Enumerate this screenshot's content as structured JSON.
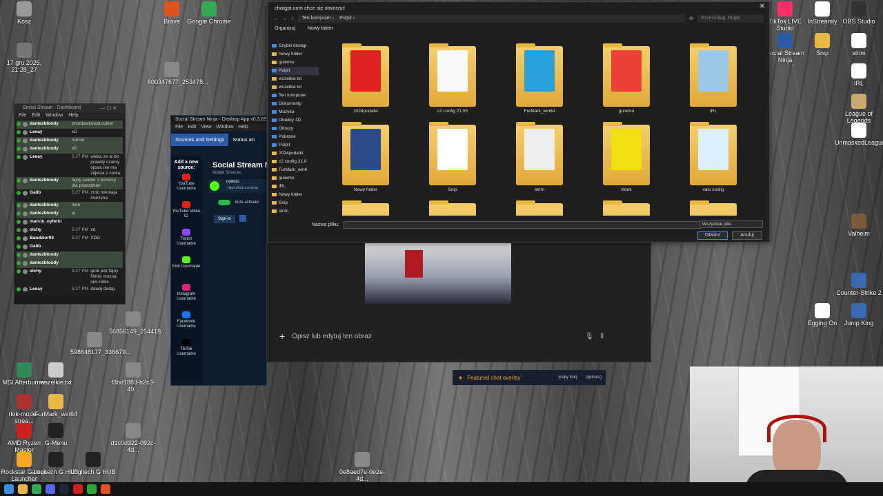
{
  "desktop": {
    "icons_left": [
      {
        "label": "Kosz",
        "color": "#999999"
      },
      {
        "label": "17 gru 2025, 21:28_27",
        "color": "#777777"
      },
      {
        "label": "Brave",
        "color": "#e0531f"
      },
      {
        "label": "Google Chrome",
        "color": "#34a853"
      },
      {
        "label": "600347677_253478...",
        "color": "#888888"
      },
      {
        "label": "56856149_254418...",
        "color": "#888888"
      },
      {
        "label": "598648177_336679...",
        "color": "#888888"
      },
      {
        "label": "MSI Afterburner",
        "color": "#2e8b57"
      },
      {
        "label": "wszelkie.txt",
        "color": "#cccccc"
      },
      {
        "label": "f3bd1883-b2c3-49...",
        "color": "#888888"
      },
      {
        "label": "rlok-model-strea...",
        "color": "#b03030"
      },
      {
        "label": "FurMark_win64",
        "color": "#e8b840"
      },
      {
        "label": "AMD Ryzen Master",
        "color": "#cc2222"
      },
      {
        "label": "G-Menu",
        "color": "#222222"
      },
      {
        "label": "d1c0d322-092c-4d...",
        "color": "#888888"
      },
      {
        "label": "Rockstar Games Launcher",
        "color": "#f5a623"
      },
      {
        "label": "Logitech G HUB",
        "color": "#222222"
      },
      {
        "label": "Logitech G HUB",
        "color": "#222222"
      },
      {
        "label": "0e8aed7e-0e2e-4d...",
        "color": "#888888"
      }
    ],
    "icons_right": [
      {
        "label": "TikTok LIVE Studio",
        "color": "#ff2d6a"
      },
      {
        "label": "InStreamly",
        "color": "#ffffff"
      },
      {
        "label": "OBS Studio",
        "color": "#333333"
      },
      {
        "label": "Social Stream Ninja",
        "color": "#2c5ca8"
      },
      {
        "label": "Snip",
        "color": "#e8b840"
      },
      {
        "label": "strim",
        "color": "#ffffff"
      },
      {
        "label": "IRL",
        "color": "#ffffff"
      },
      {
        "label": "League of Legends",
        "color": "#c8aa6e"
      },
      {
        "label": "UnmaskedLeague...",
        "color": "#ffffff"
      },
      {
        "label": "Valheim",
        "color": "#7a5a3a"
      },
      {
        "label": "Counter-Strike 2",
        "color": "#3a6ab0"
      },
      {
        "label": "Egging On",
        "color": "#ffffff"
      },
      {
        "label": "Jump King",
        "color": "#3a6ab0"
      }
    ]
  },
  "dashboard": {
    "title": "Social Stream - Dashboard",
    "menu": [
      "File",
      "Edit",
      "Window",
      "Help"
    ],
    "chat": [
      {
        "name": "dantezbloody",
        "time": "",
        "msg": "przedawkowal cukier",
        "hl": true
      },
      {
        "name": "Leeay",
        "time": "",
        "msg": "xD",
        "hl": false
      },
      {
        "name": "dantezbloody",
        "time": "",
        "msg": "rumun",
        "hl": true
      },
      {
        "name": "dantezbloody",
        "time": "",
        "msg": "xD",
        "hl": true
      },
      {
        "name": "Leeay",
        "time": "5:27 PM",
        "msg": "widac ze ai bo prawdy czarny ojciec nie ma zdjecia z corka",
        "hl": false
      },
      {
        "name": "dantezbloody",
        "time": "",
        "msg": "fajny sweter z pomocy dla powodzian",
        "hl": true
      },
      {
        "name": "Galib",
        "time": "5:27 PM",
        "msg": "zrob mikolaja murzyna",
        "hl": false
      },
      {
        "name": "dantezbloody",
        "time": "",
        "msg": "leee",
        "hl": true
      },
      {
        "name": "dantezbloody",
        "time": "",
        "msg": "ai",
        "hl": true
      },
      {
        "name": "marcin_oyferki",
        "time": "",
        "msg": "",
        "hl": false
      },
      {
        "name": "olchy",
        "time": "5:27 PM",
        "msg": "xd",
        "hl": false
      },
      {
        "name": "Bandzior93",
        "time": "5:27 PM",
        "msg": "XDD",
        "hl": false
      },
      {
        "name": "Galib",
        "time": "",
        "msg": "",
        "hl": false
      },
      {
        "name": "dantezbloody",
        "time": "",
        "msg": "",
        "hl": true
      },
      {
        "name": "dantezbloody",
        "time": "",
        "msg": "",
        "hl": true
      },
      {
        "name": "olchy",
        "time": "5:27 PM",
        "msg": "grok jest fajny filmiki mozna nim robic",
        "hl": false
      },
      {
        "name": "Leeay",
        "time": "5:27 PM",
        "msg": "dawaj dodaj spatena do jakiegos zdjecia komus xD",
        "hl": false
      }
    ]
  },
  "ninja": {
    "title": "Social Stream Ninja - Desktop App v0.3.69",
    "menu": [
      "File",
      "Edit",
      "View",
      "Window",
      "Help"
    ],
    "tabs": [
      "Sources and Settings",
      "Status an"
    ],
    "add_source": "Add a new source:",
    "heading": "Social Stream N",
    "added_sources": "Added Sources:",
    "source_name": "nowciu",
    "source_url": "https://kick.com/pop",
    "auto_activate": "Auto-activate",
    "sign_in": "Sign-in",
    "platforms": [
      {
        "label": "YouTube Username",
        "color": "#e62117"
      },
      {
        "label": "YouTube Video ID",
        "color": "#e62117"
      },
      {
        "label": "Twitch Username",
        "color": "#9146ff"
      },
      {
        "label": "Kick Username",
        "color": "#53fc18"
      },
      {
        "label": "Instagram Username",
        "color": "#d62976"
      },
      {
        "label": "Facebook Username",
        "color": "#1877f2"
      },
      {
        "label": "TikTok Username",
        "color": "#000000"
      }
    ]
  },
  "gpt": {
    "placeholder": "Opisz lub edytuj ten obraz",
    "overlay_label": "Featured chat overlay",
    "copy_link": "(copy link)",
    "options": "(options)"
  },
  "dialog": {
    "title": "chatgpt.com chce się otworzyć",
    "path": [
      "Ten komputer",
      "Pulpit"
    ],
    "search_placeholder": "Przeszukaj: Pulpit",
    "organize": "Organizuj",
    "new_folder": "Nowy folder",
    "nav": [
      {
        "label": "Szybki dostęp",
        "type": "b"
      },
      {
        "label": "Nowy folder",
        "type": "f"
      },
      {
        "label": "guiwmo",
        "type": "f"
      },
      {
        "label": "Pulpit",
        "type": "b",
        "sel": true
      },
      {
        "label": "wszelkie txt",
        "type": "f"
      },
      {
        "label": "wszelkie txt",
        "type": "f"
      },
      {
        "label": "Ten komputer",
        "type": "b"
      },
      {
        "label": "Dokumenty",
        "type": "b"
      },
      {
        "label": "Muzyka",
        "type": "b"
      },
      {
        "label": "Obiekty 3D",
        "type": "b"
      },
      {
        "label": "Obrazy",
        "type": "b"
      },
      {
        "label": "Pobrane",
        "type": "b"
      },
      {
        "label": "Pulpit",
        "type": "b"
      },
      {
        "label": "2024podatki",
        "type": "f"
      },
      {
        "label": "c2 config 21.0",
        "type": "f"
      },
      {
        "label": "FurMark_win6",
        "type": "f"
      },
      {
        "label": "guiwmo",
        "type": "f"
      },
      {
        "label": "IRL",
        "type": "f"
      },
      {
        "label": "Nowy folder",
        "type": "f"
      },
      {
        "label": "Snip",
        "type": "f"
      },
      {
        "label": "strim",
        "type": "f"
      }
    ],
    "files": [
      {
        "label": "2024podatki",
        "overlay": "#d22"
      },
      {
        "label": "c2 config 21.05",
        "overlay": "#fafafa"
      },
      {
        "label": "FurMark_win64",
        "overlay": "#2aa0d8"
      },
      {
        "label": "guiwmo",
        "overlay": "#ea4335"
      },
      {
        "label": "IRL",
        "overlay": "#9cc8e8"
      },
      {
        "label": "Nowy folder",
        "overlay": "#2a4a8a"
      },
      {
        "label": "Snip",
        "overlay": "#ffffff"
      },
      {
        "label": "strim",
        "overlay": "#eeeeee"
      },
      {
        "label": "tiktok",
        "overlay": "#f0e010"
      },
      {
        "label": "valo config",
        "overlay": "#ddeeff"
      }
    ],
    "filename_label": "Nazwa pliku:",
    "filetype": "Wszystkie pliki",
    "open": "Otwórz",
    "cancel": "Anuluj"
  },
  "taskbar": {
    "items": [
      {
        "name": "start",
        "color": "#3a8ee6"
      },
      {
        "name": "file-explorer",
        "color": "#e8b840"
      },
      {
        "name": "chrome",
        "color": "#34a853"
      },
      {
        "name": "discord",
        "color": "#5865f2"
      },
      {
        "name": "steam",
        "color": "#1b2838"
      },
      {
        "name": "obs",
        "color": "#d02020"
      },
      {
        "name": "social-stream",
        "color": "#2aa83a"
      },
      {
        "name": "brave",
        "color": "#e0531f"
      }
    ]
  }
}
